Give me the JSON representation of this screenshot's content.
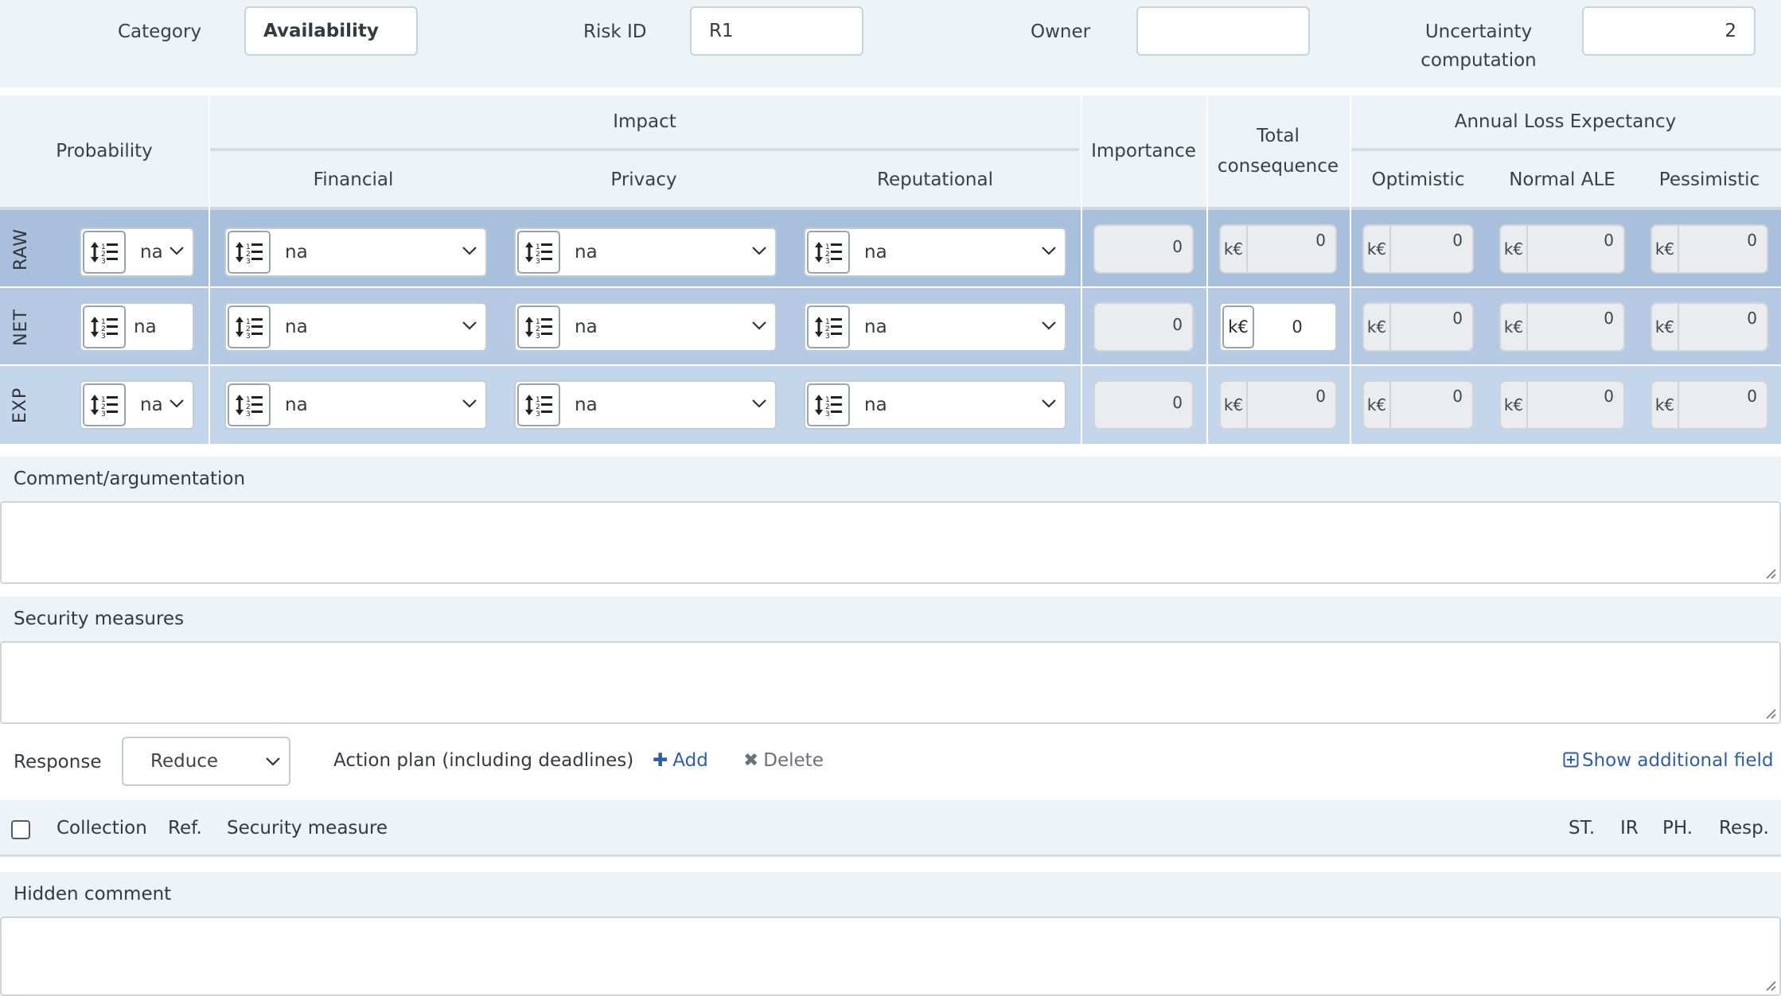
{
  "top": {
    "category_label": "Category",
    "category_value": "Availability",
    "risk_id_label": "Risk ID",
    "risk_id_value": "R1",
    "owner_label": "Owner",
    "owner_value": "",
    "uncertainty_label_1": "Uncertainty",
    "uncertainty_label_2": "computation",
    "uncertainty_value": "2"
  },
  "table": {
    "headers": {
      "probability": "Probability",
      "impact": "Impact",
      "financial": "Financial",
      "privacy": "Privacy",
      "reputational": "Reputational",
      "importance": "Importance",
      "total_1": "Total",
      "total_2": "consequence",
      "ale": "Annual Loss Expectancy",
      "optimistic": "Optimistic",
      "normal": "Normal ALE",
      "pessimistic": "Pessimistic"
    },
    "unit": "k€",
    "rows": [
      {
        "label": "RAW",
        "probability": "na",
        "financial": "na",
        "privacy": "na",
        "reputational": "na",
        "importance": "0",
        "total": "0",
        "optimistic": "0",
        "normal": "0",
        "pessimistic": "0"
      },
      {
        "label": "NET",
        "probability": "na",
        "financial": "na",
        "privacy": "na",
        "reputational": "na",
        "importance": "0",
        "total": "0",
        "optimistic": "0",
        "normal": "0",
        "pessimistic": "0"
      },
      {
        "label": "EXP",
        "probability": "na",
        "financial": "na",
        "privacy": "na",
        "reputational": "na",
        "importance": "0",
        "total": "0",
        "optimistic": "0",
        "normal": "0",
        "pessimistic": "0"
      }
    ]
  },
  "sections": {
    "comment": "Comment/argumentation",
    "security": "Security measures",
    "hidden": "Hidden comment"
  },
  "response": {
    "label": "Response",
    "value": "Reduce",
    "action_plan": "Action plan (including deadlines)",
    "add": "Add",
    "delete": "Delete",
    "show_additional": "Show additional field"
  },
  "list_columns": {
    "collection": "Collection",
    "ref": "Ref.",
    "security_measure": "Security measure",
    "st": "ST.",
    "ir": "IR",
    "ph": "PH.",
    "resp": "Resp."
  },
  "colors": {
    "raw_row": "#a9c0dc",
    "net_row": "#b5c9e2",
    "exp_row": "#c4d6ec",
    "link": "#2f5f9e",
    "header_bg": "#eef3f8"
  }
}
